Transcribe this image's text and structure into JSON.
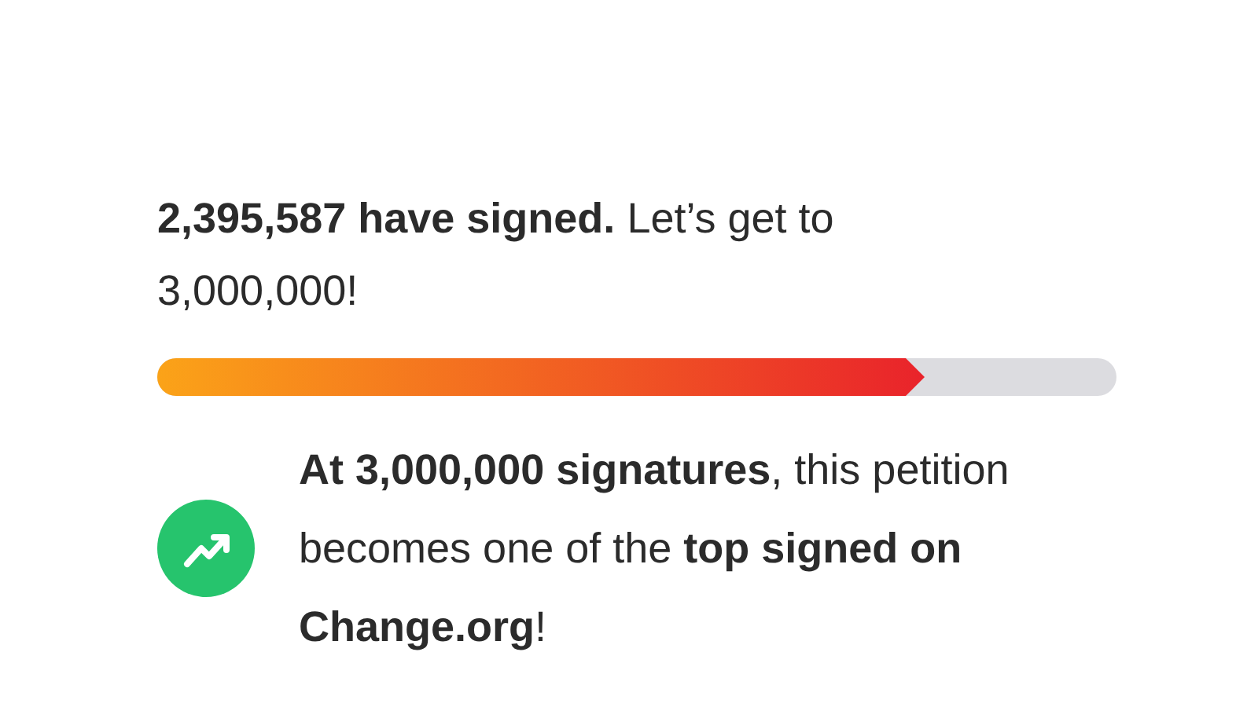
{
  "progress": {
    "headline": "**2,395,587 have signed.** Let’s get to 3,000,000!",
    "level": 0.8
  },
  "milestone": {
    "text": "**At 3,000,000 signatures**, this petition becomes one of the **top signed on Change.org**!"
  }
}
